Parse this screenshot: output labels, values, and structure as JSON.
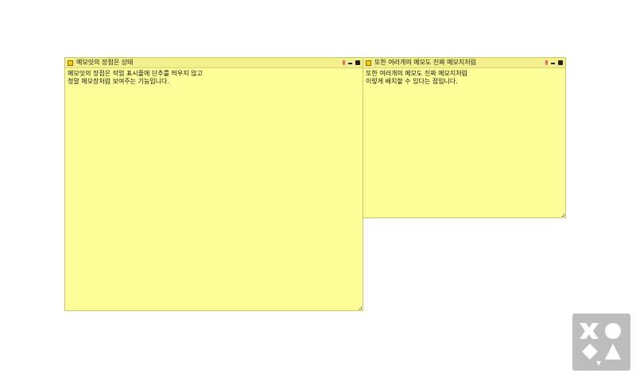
{
  "notes": [
    {
      "title": "메모잇의 장점은 상태",
      "lines": [
        "메모잇의 장점은 작업 표시줄에 단추를 띄우지 않고",
        "정말 메모장처럼 보여주는 기능입니다."
      ]
    },
    {
      "title": "또한 여러개의 메모도 진짜 메모지처럼",
      "lines": [
        "또한 여러개의 메모도 진짜 메모지처럼",
        "이렇게 배치할 수 있다는 점입니다."
      ]
    }
  ],
  "colors": {
    "note_background": "#ffff99",
    "note_titlebar": "#f2ef8c",
    "note_icon": "#f7d000",
    "pin_icon": "#e06a6a",
    "logo_background": "#bdbdbd"
  },
  "icons": {
    "note": "note-icon",
    "pin": "pin-icon",
    "minimize": "minimize-icon",
    "close": "trash-icon",
    "logo": "shapes-logo"
  }
}
